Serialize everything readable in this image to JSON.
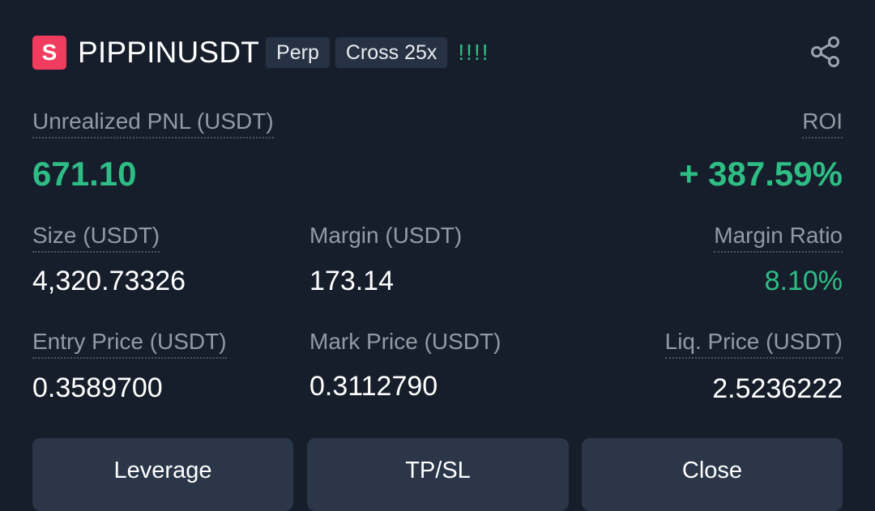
{
  "header": {
    "logo_letter": "S",
    "symbol": "PIPPINUSDT",
    "tag_contract": "Perp",
    "tag_margin": "Cross 25x",
    "warning": "!!!!"
  },
  "pnl": {
    "label": "Unrealized PNL (USDT)",
    "value": "671.10",
    "roi_label": "ROI",
    "roi_value": "+ 387.59%"
  },
  "row1": {
    "size_label": "Size (USDT)",
    "size_value": "4,320.73326",
    "margin_label": "Margin (USDT)",
    "margin_value": "173.14",
    "margin_ratio_label": "Margin Ratio",
    "margin_ratio_value": "8.10%"
  },
  "row2": {
    "entry_label": "Entry Price (USDT)",
    "entry_value": "0.3589700",
    "mark_label": "Mark Price (USDT)",
    "mark_value": "0.3112790",
    "liq_label": "Liq. Price (USDT)",
    "liq_value": "2.5236222"
  },
  "buttons": {
    "leverage": "Leverage",
    "tpsl": "TP/SL",
    "close": "Close"
  },
  "icons": {
    "logo": "symbol-logo-icon",
    "share": "share-icon"
  },
  "colors": {
    "background": "#161e2b",
    "positive": "#2ebd85",
    "logo": "#ef3c5f",
    "tag_bg": "#263243",
    "button_bg": "#2b3648"
  }
}
